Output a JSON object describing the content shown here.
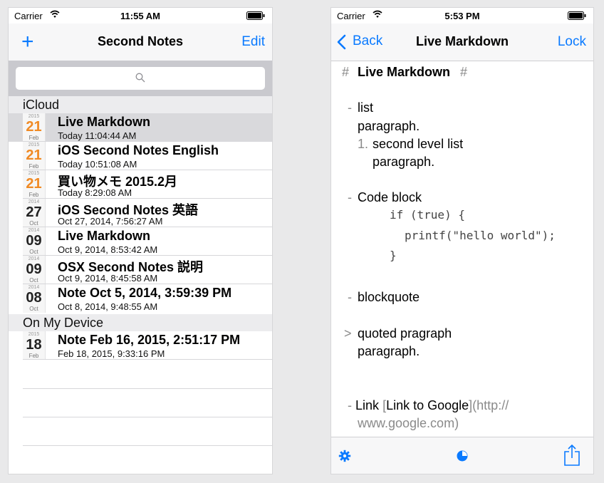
{
  "left": {
    "status": {
      "carrier": "Carrier",
      "time": "11:55 AM"
    },
    "nav": {
      "add_label": "+",
      "title": "Second Notes",
      "edit_label": "Edit"
    },
    "sections": [
      {
        "label": "iCloud"
      },
      {
        "label": "On My Device"
      }
    ],
    "notes": [
      {
        "year": "2015",
        "day": "21",
        "month": "Feb",
        "title": "Live Markdown",
        "subtitle": "Today 11:04:44 AM"
      },
      {
        "year": "2015",
        "day": "21",
        "month": "Feb",
        "title": "iOS Second Notes English",
        "subtitle": "Today 10:51:08 AM"
      },
      {
        "year": "2015",
        "day": "21",
        "month": "Feb",
        "title": "買い物メモ 2015.2月",
        "subtitle": "Today 8:29:08 AM"
      },
      {
        "year": "2014",
        "day": "27",
        "month": "Oct",
        "title": "iOS Second Notes 英語",
        "subtitle": "Oct 27, 2014, 7:56:27 AM"
      },
      {
        "year": "2014",
        "day": "09",
        "month": "Oct",
        "title": "Live Markdown",
        "subtitle": "Oct 9, 2014, 8:53:42 AM"
      },
      {
        "year": "2014",
        "day": "09",
        "month": "Oct",
        "title": "OSX Second Notes 説明",
        "subtitle": "Oct 9, 2014, 8:45:58 AM"
      },
      {
        "year": "2014",
        "day": "08",
        "month": "Oct",
        "title": "Note Oct 5, 2014, 3:59:39 PM",
        "subtitle": "Oct 8, 2014, 9:48:55 AM"
      },
      {
        "year": "2015",
        "day": "18",
        "month": "Feb",
        "title": "Note Feb 16, 2015, 2:51:17 PM",
        "subtitle": "Feb 18, 2015, 9:33:16 PM"
      }
    ]
  },
  "right": {
    "status": {
      "carrier": "Carrier",
      "time": "5:53 PM"
    },
    "nav": {
      "back_label": "Back",
      "title": "Live Markdown",
      "lock_label": "Lock"
    },
    "content": {
      "h1_open": "#",
      "h1_text": "Live Markdown",
      "h1_close": "#",
      "list_marker": "-",
      "list_item": "list",
      "list_para": "paragraph.",
      "sublist_marker": "1.",
      "sublist_item": "second level list",
      "sublist_para": "paragraph.",
      "code_marker": "-",
      "code_title": "Code block",
      "code_line1": "if (true) {",
      "code_line2": "printf(\"hello world\");",
      "code_line3": "}",
      "bq_marker": "-",
      "bq_title": "blockquote",
      "quote_marker": ">",
      "quote_line1": "quoted pragraph",
      "quote_line2": "paragraph.",
      "link_marker": "-",
      "link_word": "Link",
      "link_open": "[",
      "link_text": "Link to Google",
      "link_close": "]",
      "link_url1": "(http://",
      "link_url2": "www.google.com)"
    }
  },
  "colors": {
    "accent": "#0a7aff",
    "date_orange": "#f08a24"
  }
}
